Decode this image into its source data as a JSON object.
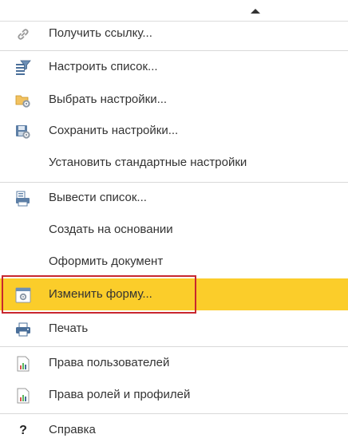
{
  "menu": {
    "items": [
      {
        "id": "get-link",
        "label": "Получить ссылку...",
        "icon": "link-icon"
      },
      {
        "id": "configure-list",
        "label": "Настроить список...",
        "icon": "filter-list-icon"
      },
      {
        "id": "choose-settings",
        "label": "Выбрать настройки...",
        "icon": "folder-gear-icon"
      },
      {
        "id": "save-settings",
        "label": "Сохранить настройки...",
        "icon": "save-gear-icon"
      },
      {
        "id": "default-settings",
        "label": "Установить стандартные настройки",
        "icon": ""
      },
      {
        "id": "print-list",
        "label": "Вывести список...",
        "icon": "list-print-icon"
      },
      {
        "id": "create-based",
        "label": "Создать на основании",
        "icon": ""
      },
      {
        "id": "make-document",
        "label": "Оформить документ",
        "icon": ""
      },
      {
        "id": "change-form",
        "label": "Изменить форму...",
        "icon": "form-settings-icon",
        "highlighted": true
      },
      {
        "id": "print",
        "label": "Печать",
        "icon": "printer-icon"
      },
      {
        "id": "user-rights",
        "label": "Права пользователей",
        "icon": "report-chart-icon"
      },
      {
        "id": "role-rights",
        "label": "Права ролей и профилей",
        "icon": "report-chart-icon"
      },
      {
        "id": "help",
        "label": "Справка",
        "icon": "question-icon"
      }
    ],
    "help_glyph": "?"
  },
  "colors": {
    "highlight": "#fbcd2a",
    "focus_border": "#c8272e",
    "separator": "#d9d9d9",
    "text": "#333333"
  }
}
